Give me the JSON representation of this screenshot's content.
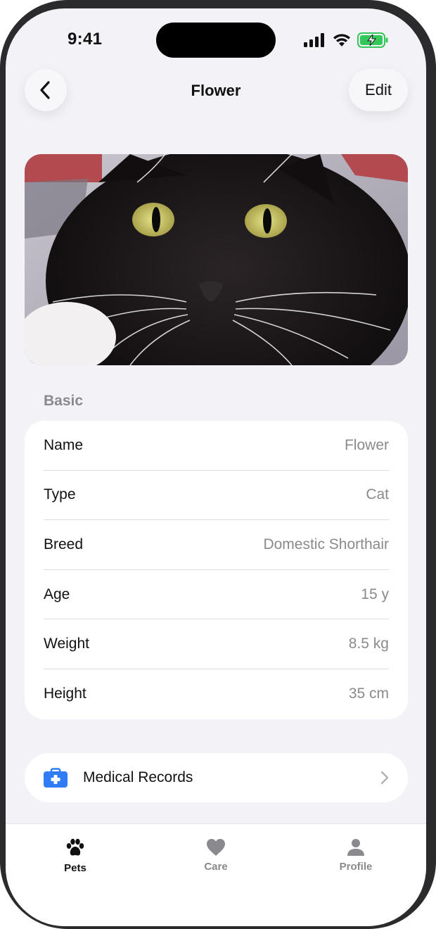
{
  "status_bar": {
    "time": "9:41"
  },
  "nav": {
    "title": "Flower",
    "edit_label": "Edit"
  },
  "section": {
    "header": "Basic"
  },
  "details": [
    {
      "label": "Name",
      "value": "Flower"
    },
    {
      "label": "Type",
      "value": "Cat"
    },
    {
      "label": "Breed",
      "value": "Domestic Shorthair"
    },
    {
      "label": "Age",
      "value": "15 y"
    },
    {
      "label": "Weight",
      "value": "8.5 kg"
    },
    {
      "label": "Height",
      "value": "35 cm"
    }
  ],
  "medical_records": {
    "label": "Medical Records"
  },
  "tabs": [
    {
      "label": "Pets",
      "icon": "paw-icon"
    },
    {
      "label": "Care",
      "icon": "heart-icon"
    },
    {
      "label": "Profile",
      "icon": "person-icon"
    }
  ],
  "colors": {
    "accent_blue": "#2f7cf6",
    "secondary_text": "#8a8a8e",
    "battery_green": "#34c759"
  }
}
